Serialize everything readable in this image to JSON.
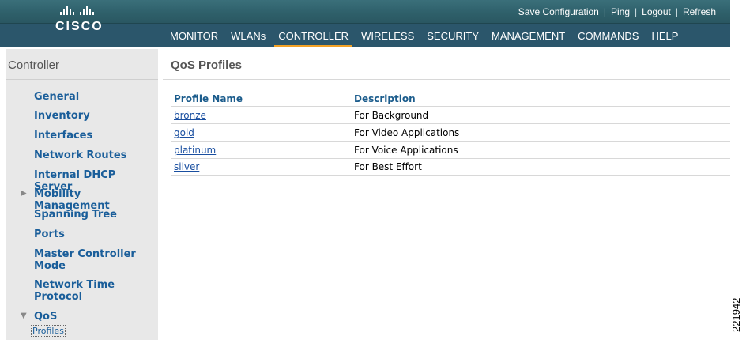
{
  "header": {
    "logo_text": "CISCO",
    "links": [
      "Save Configuration",
      "Ping",
      "Logout",
      "Refresh"
    ],
    "nav": [
      "MONITOR",
      "WLANs",
      "CONTROLLER",
      "WIRELESS",
      "SECURITY",
      "MANAGEMENT",
      "COMMANDS",
      "HELP"
    ],
    "active_nav": "CONTROLLER",
    "colors": {
      "header_bg": "#2b566b",
      "active_underline": "#f2a125"
    }
  },
  "sidebar": {
    "title": "Controller",
    "items": [
      {
        "label": "General"
      },
      {
        "label": "Inventory"
      },
      {
        "label": "Interfaces"
      },
      {
        "label": "Network Routes"
      },
      {
        "label": "Internal DHCP Server"
      },
      {
        "label": "Mobility Management",
        "expand": "collapsed"
      },
      {
        "label": "Spanning Tree"
      },
      {
        "label": "Ports"
      },
      {
        "label": "Master Controller Mode"
      },
      {
        "label": "Network Time Protocol"
      },
      {
        "label": "QoS",
        "expand": "expanded"
      }
    ],
    "sub_item": "Profiles"
  },
  "main": {
    "title": "QoS Profiles",
    "columns": [
      "Profile Name",
      "Description"
    ],
    "rows": [
      {
        "name": "bronze",
        "description": "For Background"
      },
      {
        "name": "gold",
        "description": "For Video Applications"
      },
      {
        "name": "platinum",
        "description": "For Voice Applications"
      },
      {
        "name": "silver",
        "description": "For Best Effort"
      }
    ]
  },
  "figure_id": "221942"
}
